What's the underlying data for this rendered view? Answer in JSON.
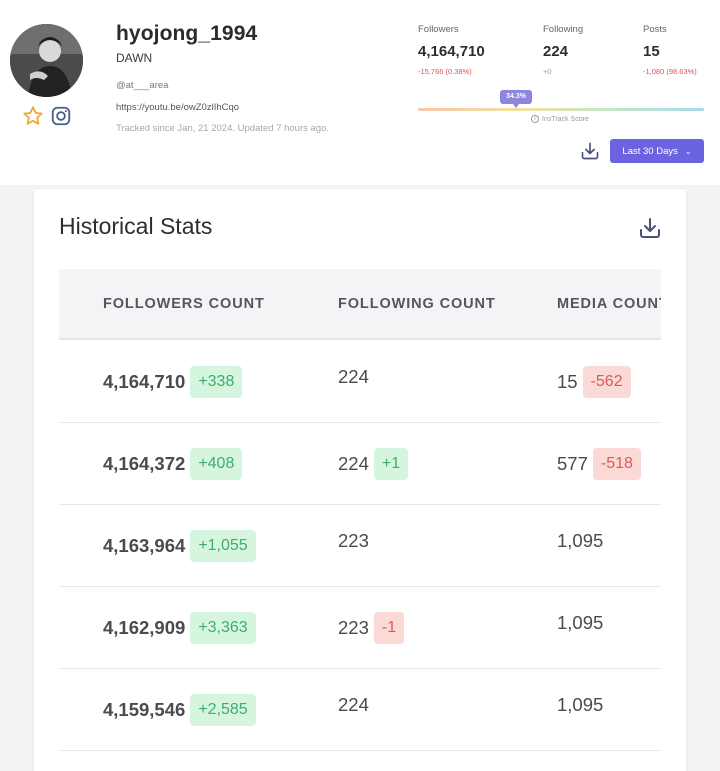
{
  "profile": {
    "username": "hyojong_1994",
    "full_name": "DAWN",
    "bio": "@at___area",
    "link": "https://youtu.be/owZ0zlIhCqo",
    "tracked": "Tracked since Jan, 21 2024. Updated 7 hours ago."
  },
  "stats": {
    "followers": {
      "label": "Followers",
      "value": "4,164,710",
      "change": "-15,766 (0.38%)"
    },
    "following": {
      "label": "Following",
      "value": "224",
      "change": "+0"
    },
    "posts": {
      "label": "Posts",
      "value": "15",
      "change": "-1,080 (98.63%)"
    }
  },
  "score": {
    "value": "34.3%",
    "fraction": 0.343,
    "label": "InsTrack Score"
  },
  "controls": {
    "period_label": "Last 30 Days"
  },
  "historical": {
    "title": "Historical Stats",
    "columns": [
      "FOLLOWERS COUNT",
      "FOLLOWING COUNT",
      "MEDIA COUNT"
    ],
    "rows": [
      {
        "followers": "4,164,710",
        "followers_delta": "+338",
        "following": "224",
        "following_delta": "",
        "media": "15",
        "media_delta": "-562"
      },
      {
        "followers": "4,164,372",
        "followers_delta": "+408",
        "following": "224",
        "following_delta": "+1",
        "media": "577",
        "media_delta": "-518"
      },
      {
        "followers": "4,163,964",
        "followers_delta": "+1,055",
        "following": "223",
        "following_delta": "",
        "media": "1,095",
        "media_delta": ""
      },
      {
        "followers": "4,162,909",
        "followers_delta": "+3,363",
        "following": "223",
        "following_delta": "-1",
        "media": "1,095",
        "media_delta": ""
      },
      {
        "followers": "4,159,546",
        "followers_delta": "+2,585",
        "following": "224",
        "following_delta": "",
        "media": "1,095",
        "media_delta": ""
      }
    ]
  },
  "colors": {
    "accent": "#6c63e0",
    "positive": "#3eae6a",
    "negative": "#dc5a55",
    "score_pill": "#8c86df"
  },
  "icons": {
    "favorite": "star-icon",
    "instagram": "instagram-icon",
    "download": "download-icon",
    "info": "info-icon",
    "dropdown": "chevron-down-icon"
  }
}
